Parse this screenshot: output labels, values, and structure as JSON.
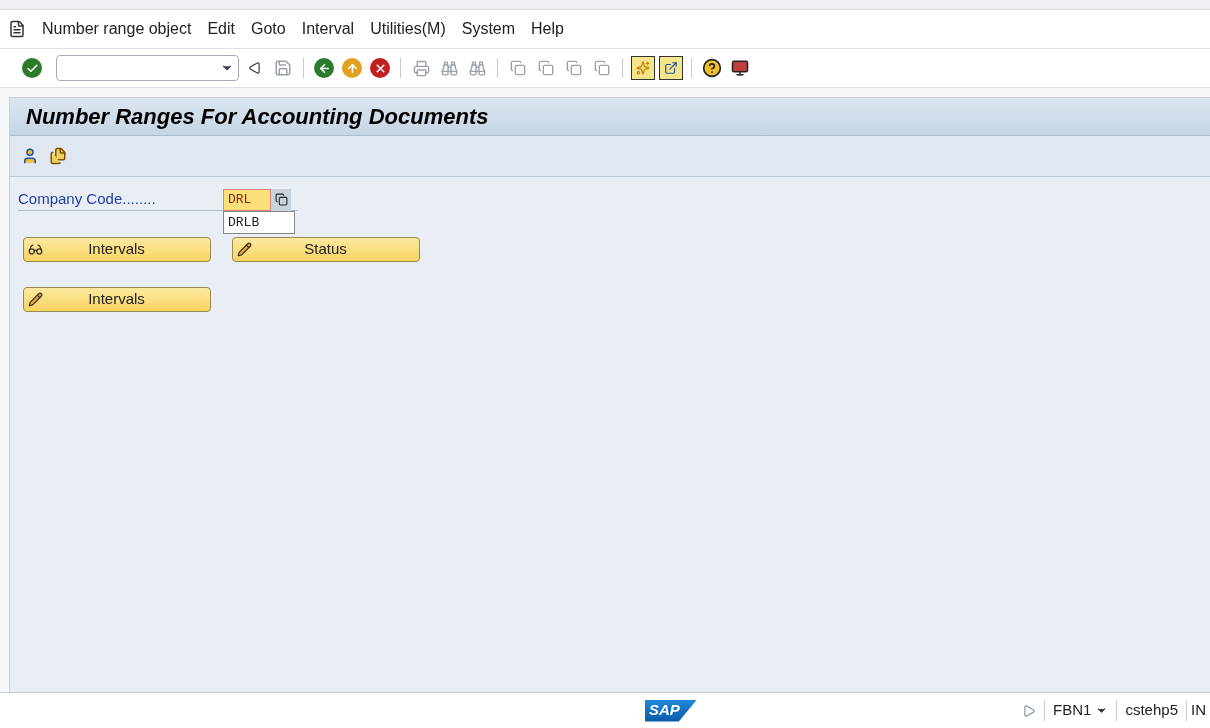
{
  "menu_bar": {
    "items": [
      "Number range object",
      "Edit",
      "Goto",
      "Interval",
      "Utilities(M)",
      "System",
      "Help"
    ]
  },
  "title": "Number Ranges For Accounting Documents",
  "form": {
    "label": "Company Code........",
    "value": "DRL",
    "suggestions": [
      "DRLB"
    ]
  },
  "buttons": [
    {
      "label": "Intervals",
      "kind": "display"
    },
    {
      "label": "Status",
      "kind": "change"
    },
    {
      "label": "Intervals",
      "kind": "change"
    }
  ],
  "status_bar": {
    "logo": "SAP",
    "transaction": "FBN1",
    "server": "cstehp5",
    "mode": "IN"
  }
}
